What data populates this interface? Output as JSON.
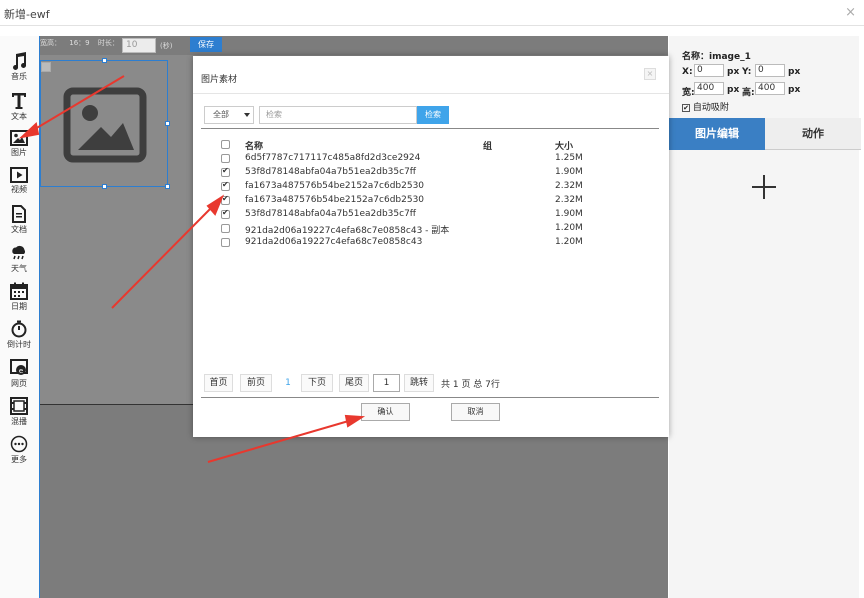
{
  "window": {
    "title": "新增-ewf",
    "close": "×"
  },
  "sidebar": {
    "items": [
      {
        "label": "音乐",
        "icon": "music-icon"
      },
      {
        "label": "文本",
        "icon": "text-icon"
      },
      {
        "label": "图片",
        "icon": "image-icon"
      },
      {
        "label": "视频",
        "icon": "video-icon"
      },
      {
        "label": "文档",
        "icon": "document-icon"
      },
      {
        "label": "天气",
        "icon": "weather-icon"
      },
      {
        "label": "日期",
        "icon": "calendar-icon"
      },
      {
        "label": "倒计时",
        "icon": "stopwatch-icon"
      },
      {
        "label": "网页",
        "icon": "webpage-icon"
      },
      {
        "label": "混播",
        "icon": "mixed-play-icon"
      },
      {
        "label": "更多",
        "icon": "more-icon"
      }
    ]
  },
  "toolbar": {
    "ratio_label": "宽高：",
    "ratio_value": "16：9",
    "duration_label": "时长：",
    "duration_value": "10",
    "duration_unit": "(秒)",
    "save_label": "保存"
  },
  "properties": {
    "name_label": "名称：",
    "name_value": "image_1",
    "x_label": "X:",
    "x_value": "0",
    "y_label": "Y:",
    "y_value": "0",
    "w_label": "宽:",
    "w_value": "400",
    "h_label": "高:",
    "h_value": "400",
    "unit": "px",
    "snap_label": "自动吸附",
    "snap_checked": true,
    "tab_edit": "图片编辑",
    "tab_animation": "动作"
  },
  "modal": {
    "title": "图片素材",
    "close": "×",
    "filter_value": "全部",
    "search_placeholder": "检索",
    "search_button": "检索",
    "columns": {
      "name": "名称",
      "group": "组",
      "size": "大小"
    },
    "rows": [
      {
        "name": "6d5f7787c717117c485a8fd2d3ce2924",
        "group": "",
        "size": "1.25M",
        "checked": false
      },
      {
        "name": "53f8d78148abfa04a7b51ea2db35c7ff",
        "group": "",
        "size": "1.90M",
        "checked": true
      },
      {
        "name": "fa1673a487576b54be2152a7c6db2530",
        "group": "",
        "size": "2.32M",
        "checked": true
      },
      {
        "name": "fa1673a487576b54be2152a7c6db2530",
        "group": "",
        "size": "2.32M",
        "checked": true
      },
      {
        "name": "53f8d78148abfa04a7b51ea2db35c7ff",
        "group": "",
        "size": "1.90M",
        "checked": true
      },
      {
        "name": "921da2d06a19227c4efa68c7e0858c43 - 副本",
        "group": "",
        "size": "1.20M",
        "checked": false
      },
      {
        "name": "921da2d06a19227c4efa68c7e0858c43",
        "group": "",
        "size": "1.20M",
        "checked": false
      }
    ],
    "pagination": {
      "first": "首页",
      "prev": "前页",
      "current": "1",
      "next": "下页",
      "last": "尾页",
      "jump_value": "1",
      "jump": "跳转",
      "info": "共 1 页 总 7行"
    },
    "confirm": "确认",
    "cancel": "取消"
  },
  "colors": {
    "accent": "#2d7ed0",
    "search": "#3fa4ea",
    "arrow": "#e8382e",
    "tab_active": "#3a7fc4"
  }
}
